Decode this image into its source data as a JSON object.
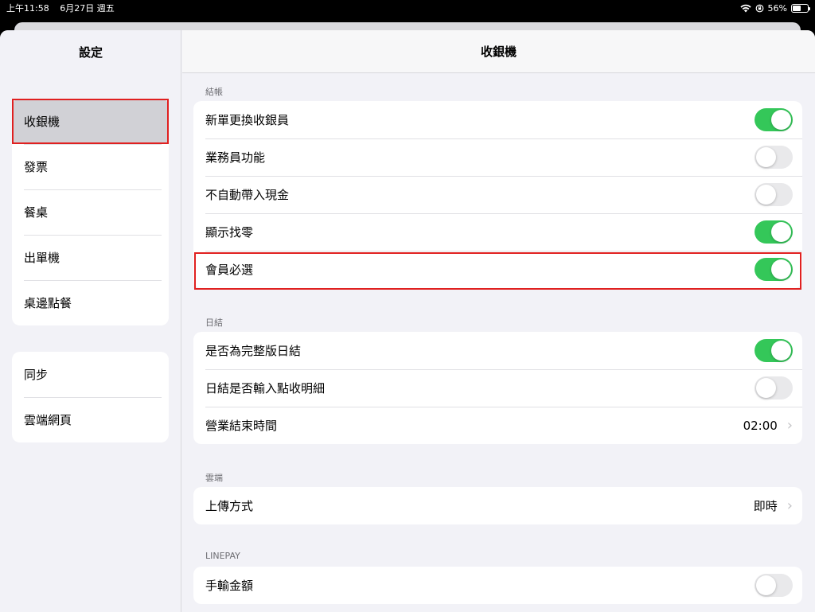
{
  "status_bar": {
    "time": "上午11:58",
    "date": "6月27日 週五",
    "battery": "56%",
    "battery_level": 0.56
  },
  "sidebar": {
    "title": "設定",
    "groups": [
      {
        "items": [
          {
            "label": "收銀機"
          },
          {
            "label": "發票"
          },
          {
            "label": "餐桌"
          },
          {
            "label": "出單機"
          },
          {
            "label": "桌邊點餐"
          }
        ]
      },
      {
        "items": [
          {
            "label": "同步"
          },
          {
            "label": "雲端網頁"
          }
        ]
      }
    ],
    "selected": "收銀機"
  },
  "detail": {
    "title": "收銀機",
    "sections": [
      {
        "header": "結帳",
        "rows": [
          {
            "label": "新單更換收銀員",
            "toggle": true
          },
          {
            "label": "業務員功能",
            "toggle": false
          },
          {
            "label": "不自動帶入現金",
            "toggle": false
          },
          {
            "label": "顯示找零",
            "toggle": true
          },
          {
            "label": "會員必選",
            "toggle": true
          }
        ]
      },
      {
        "header": "日結",
        "rows": [
          {
            "label": "是否為完整版日結",
            "toggle": true
          },
          {
            "label": "日結是否輸入點收明細",
            "toggle": false
          },
          {
            "label": "營業結束時間",
            "value": "02:00"
          }
        ]
      },
      {
        "header": "雲端",
        "rows": [
          {
            "label": "上傳方式",
            "value": "即時"
          }
        ]
      },
      {
        "header": "LINEPAY",
        "rows": [
          {
            "label": "手輸金額",
            "toggle": false
          }
        ]
      }
    ]
  },
  "icons": {
    "wifi": "wifi-icon",
    "orientation_lock": "orientation-lock-icon",
    "battery": "battery-icon",
    "chevron": "chevron-right-icon"
  },
  "colors": {
    "toggle_on": "#34c759",
    "toggle_off": "#e9e9eb",
    "highlight": "#e02020",
    "background": "#f2f2f7"
  }
}
